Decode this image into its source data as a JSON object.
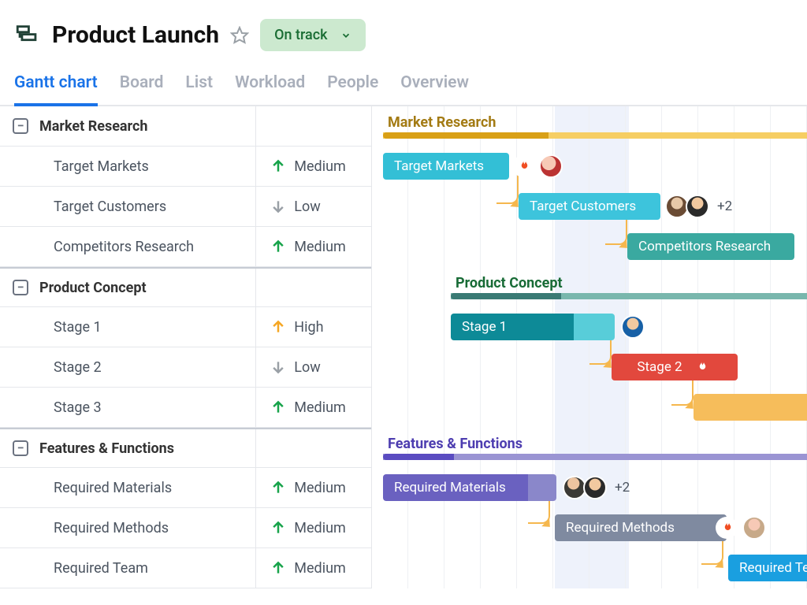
{
  "header": {
    "title": "Product Launch",
    "status": "On track"
  },
  "tabs": [
    {
      "label": "Gantt chart",
      "active": true
    },
    {
      "label": "Board"
    },
    {
      "label": "List"
    },
    {
      "label": "Workload"
    },
    {
      "label": "People"
    },
    {
      "label": "Overview"
    }
  ],
  "sections": [
    {
      "name": "Market Research",
      "color_title": "#a37b14",
      "bar_main": "#d9a016",
      "bar_light": "#f6ce63",
      "tasks": [
        {
          "name": "Target Markets",
          "priority": "Medium",
          "arrow": "up-green"
        },
        {
          "name": "Target Customers",
          "priority": "Low",
          "arrow": "down-grey"
        },
        {
          "name": "Competitors Research",
          "priority": "Medium",
          "arrow": "up-green"
        }
      ]
    },
    {
      "name": "Product Concept",
      "color_title": "#186b36",
      "bar_main": "#3a7a74",
      "bar_light": "#79b7ad",
      "tasks": [
        {
          "name": "Stage 1",
          "priority": "High",
          "arrow": "up-orange"
        },
        {
          "name": "Stage 2",
          "priority": "Low",
          "arrow": "down-grey"
        },
        {
          "name": "Stage 3",
          "priority": "Medium",
          "arrow": "up-green"
        }
      ]
    },
    {
      "name": "Features & Functions",
      "color_title": "#4d3db0",
      "bar_main": "#5a4cc1",
      "bar_light": "#9a94d3",
      "tasks": [
        {
          "name": "Required Materials",
          "priority": "Medium",
          "arrow": "up-green"
        },
        {
          "name": "Required Methods",
          "priority": "Medium",
          "arrow": "up-green"
        },
        {
          "name": "Required Team",
          "priority": "Medium",
          "arrow": "up-green"
        }
      ]
    }
  ],
  "bars": {
    "target_markets": "Target Markets",
    "target_customers": "Target Customers",
    "competitors_research": "Competitors Research",
    "stage1": "Stage 1",
    "stage2": "Stage 2",
    "required_materials": "Required Materials",
    "required_methods": "Required Methods",
    "required_team": "Required Team"
  },
  "plus_counts": {
    "two": "+2"
  }
}
